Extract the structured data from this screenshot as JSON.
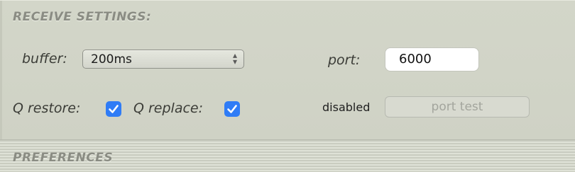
{
  "receive_settings": {
    "title": "RECEIVE SETTINGS:",
    "buffer_label": "buffer:",
    "buffer_value": "200ms",
    "port_label": "port:",
    "port_value": "6000",
    "q_restore_label": "Q restore:",
    "q_restore_checked": true,
    "q_replace_label": "Q replace:",
    "q_replace_checked": true,
    "status_text": "disabled",
    "port_test_label": "port test"
  },
  "preferences": {
    "title": "PREFERENCES"
  },
  "colors": {
    "checkbox_accent": "#2f7cf6",
    "panel_bg": "#d3d6c9"
  }
}
